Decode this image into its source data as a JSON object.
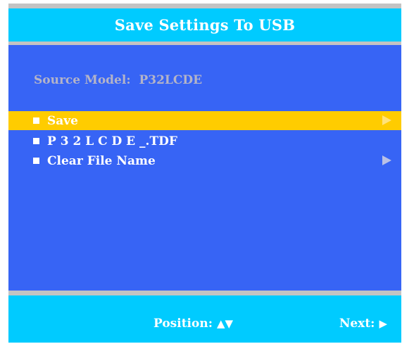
{
  "title": "Save Settings To USB",
  "source_model": {
    "label": "Source Model:",
    "value": "P32LCDE"
  },
  "menu": {
    "items": [
      {
        "label": "Save",
        "selected": true,
        "has_arrow": true
      },
      {
        "label": "P 3 2 L C D E _.TDF",
        "selected": false,
        "has_arrow": false
      },
      {
        "label": "Clear File Name",
        "selected": false,
        "has_arrow": true
      }
    ]
  },
  "footer": {
    "position_label": "Position:",
    "position_symbol": "▲▼",
    "next_label": "Next:",
    "next_symbol": "▶"
  },
  "colors": {
    "title_bar": "#00cbff",
    "main_background": "#3764f5",
    "selection_highlight": "#ffcc00",
    "separator": "#c3c3c3"
  }
}
